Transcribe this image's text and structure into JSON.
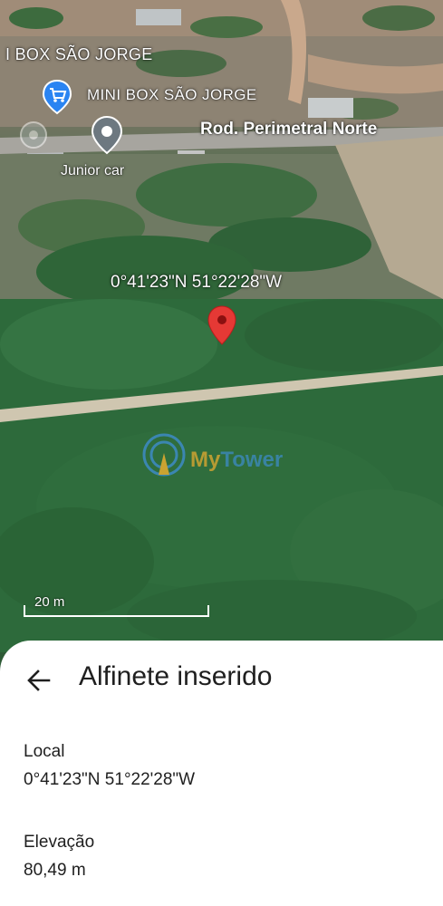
{
  "map": {
    "poi_top_label": "I BOX SÃO JORGE",
    "poi_shop_label": "MINI BOX SÃO JORGE",
    "road_label": "Rod. Perimetral Norte",
    "junior_label": "Junior car",
    "pin_coordinates": "0°41'23\"N 51°22'28\"W",
    "scale_label": "20 m",
    "watermark_my": "My",
    "watermark_tower": "Tower",
    "pin_color": "#e53935"
  },
  "sheet": {
    "title": "Alfinete inserido",
    "location_label": "Local",
    "location_value": "0°41'23\"N 51°22'28\"W",
    "elevation_label": "Elevação",
    "elevation_value": "80,49 m"
  },
  "icons": [
    "shopping-cart-pin-icon",
    "location-pin-icon",
    "red-map-pin-icon",
    "back-arrow-icon",
    "scale-bar-icon"
  ]
}
